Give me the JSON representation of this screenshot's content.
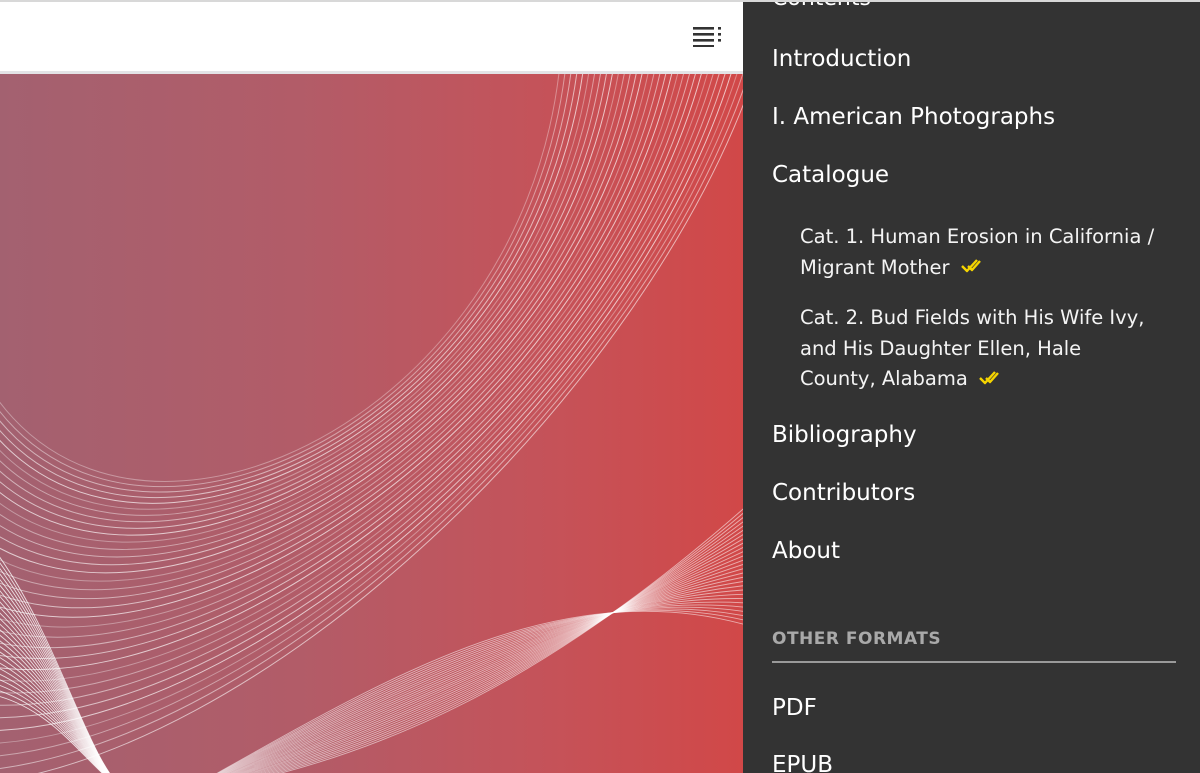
{
  "header": {
    "toc_toggle_icon": "list-menu-icon"
  },
  "hero": {
    "gradient_colors": [
      "#a36170",
      "#c4535a",
      "#d14848"
    ],
    "line_color": "#ffffff"
  },
  "toc": {
    "heading": "Contents",
    "items": [
      {
        "label": "Introduction"
      },
      {
        "label": "I. American Photographs"
      },
      {
        "label": "Catalogue"
      }
    ],
    "catalogue_entries": [
      {
        "line1": "Cat. 1. Human Erosion in California /",
        "line2": "Migrant Mother",
        "status_icon": "double-check-icon"
      },
      {
        "line1": "Cat. 2. Bud Fields with His Wife Ivy,",
        "line2": "and His Daughter Ellen, Hale",
        "line3": "County, Alabama",
        "status_icon": "double-check-icon"
      }
    ],
    "after_items": [
      {
        "label": "Bibliography"
      },
      {
        "label": "Contributors"
      },
      {
        "label": "About"
      }
    ],
    "other_formats_label": "OTHER FORMATS",
    "formats": [
      {
        "label": "PDF"
      },
      {
        "label": "EPUB"
      }
    ],
    "check_color": "#f5d400",
    "panel_color": "#333333"
  }
}
